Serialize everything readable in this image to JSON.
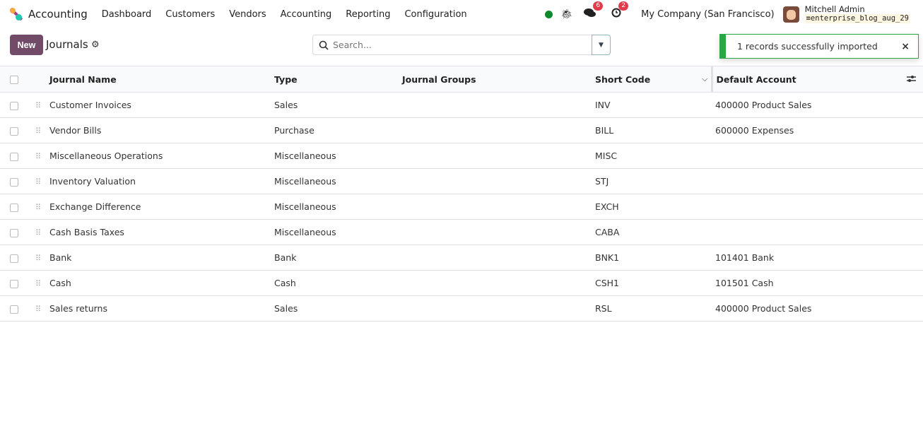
{
  "nav": {
    "app": "Accounting",
    "menus": [
      "Dashboard",
      "Customers",
      "Vendors",
      "Accounting",
      "Reporting",
      "Configuration"
    ],
    "messages_count": "6",
    "activities_count": "2",
    "company": "My Company (San Francisco)",
    "user": "Mitchell Admin",
    "database": "enterprise_blog_aug_29",
    "status_color": "#0a8a2a"
  },
  "control": {
    "new_label": "New",
    "title": "Journals",
    "search_placeholder": "Search..."
  },
  "toast": {
    "message": "1 records successfully imported",
    "close": "×"
  },
  "table": {
    "columns": [
      "Journal Name",
      "Type",
      "Journal Groups",
      "Short Code",
      "Default Account"
    ],
    "rows": [
      [
        "Customer Invoices",
        "Sales",
        "",
        "INV",
        "400000 Product Sales"
      ],
      [
        "Vendor Bills",
        "Purchase",
        "",
        "BILL",
        "600000 Expenses"
      ],
      [
        "Miscellaneous Operations",
        "Miscellaneous",
        "",
        "MISC",
        ""
      ],
      [
        "Inventory Valuation",
        "Miscellaneous",
        "",
        "STJ",
        ""
      ],
      [
        "Exchange Difference",
        "Miscellaneous",
        "",
        "EXCH",
        ""
      ],
      [
        "Cash Basis Taxes",
        "Miscellaneous",
        "",
        "CABA",
        ""
      ],
      [
        "Bank",
        "Bank",
        "",
        "BNK1",
        "101401 Bank"
      ],
      [
        "Cash",
        "Cash",
        "",
        "CSH1",
        "101501 Cash"
      ],
      [
        "Sales returns",
        "Sales",
        "",
        "RSL",
        "400000 Product Sales"
      ]
    ]
  },
  "colors": {
    "brand": "#714b67",
    "success": "#28a745",
    "badge": "#e23b4b"
  }
}
